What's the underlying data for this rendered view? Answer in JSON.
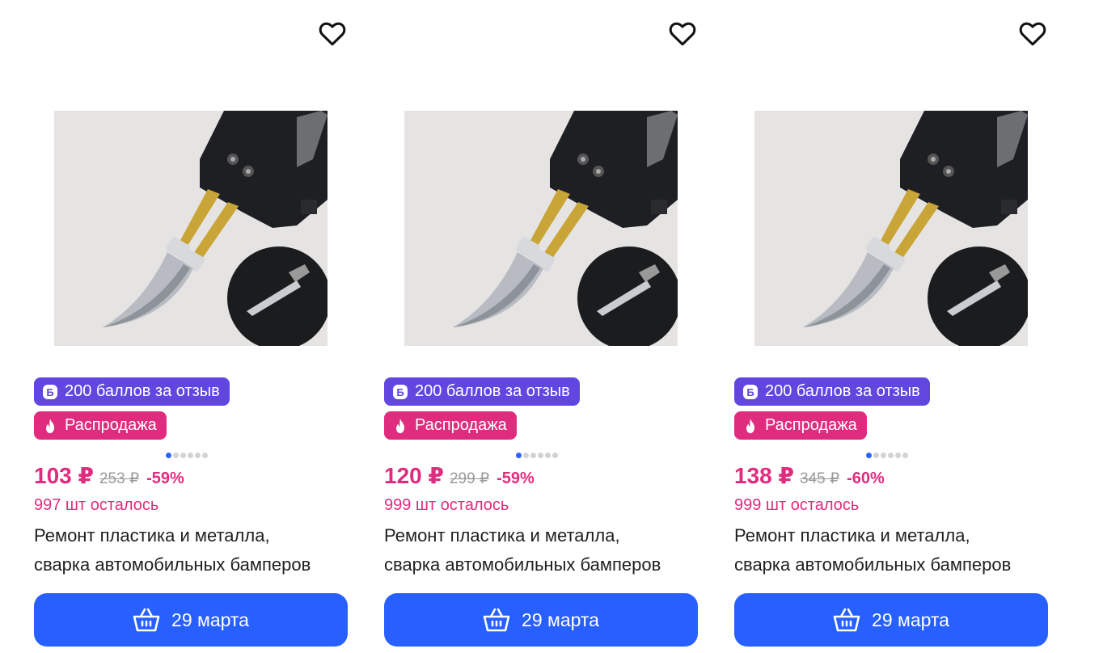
{
  "colors": {
    "accent_blue": "#2760ff",
    "points_badge": "#6147e0",
    "sale_badge": "#e02c7f",
    "price": "#e02c7f",
    "old_price": "#9a9a9e"
  },
  "icons": {
    "favorite": "heart-outline-icon",
    "points": "letter-b-coin-icon",
    "sale": "flame-icon",
    "cart": "basket-icon"
  },
  "products": [
    {
      "points_badge": "200 баллов за отзыв",
      "sale_badge": "Распродажа",
      "price": "103 ₽",
      "old_price": "253 ₽",
      "discount": "-59%",
      "stock": "997 шт осталось",
      "title_line1": "Ремонт пластика и металла,",
      "title_line2": "сварка автомобильных бамперов",
      "delivery_button": "29 марта",
      "image_count": 6,
      "active_image": 1
    },
    {
      "points_badge": "200 баллов за отзыв",
      "sale_badge": "Распродажа",
      "price": "120 ₽",
      "old_price": "299 ₽",
      "discount": "-59%",
      "stock": "999 шт осталось",
      "title_line1": "Ремонт пластика и металла,",
      "title_line2": "сварка автомобильных бамперов",
      "delivery_button": "29 марта",
      "image_count": 6,
      "active_image": 1
    },
    {
      "points_badge": "200 баллов за отзыв",
      "sale_badge": "Распродажа",
      "price": "138 ₽",
      "old_price": "345 ₽",
      "discount": "-60%",
      "stock": "999 шт осталось",
      "title_line1": "Ремонт пластика и металла,",
      "title_line2": "сварка автомобильных бамперов",
      "delivery_button": "29 марта",
      "image_count": 6,
      "active_image": 1
    }
  ]
}
